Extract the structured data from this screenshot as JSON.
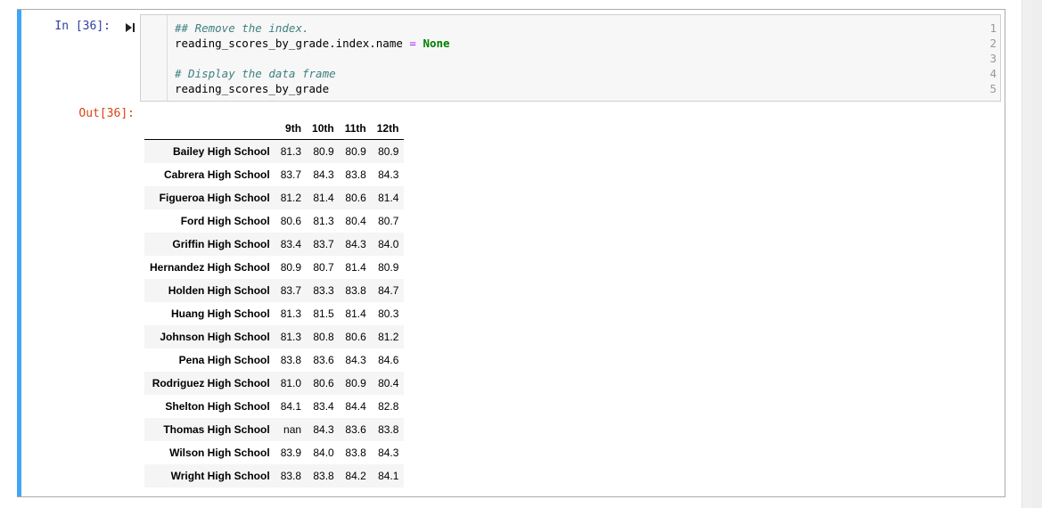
{
  "input": {
    "prompt": "In [36]:",
    "lines": [
      {
        "num": "1",
        "parts": [
          {
            "t": "## Remove the index.",
            "cls": "c-comment"
          }
        ]
      },
      {
        "num": "2",
        "parts": [
          {
            "t": "reading_scores_by_grade.index.name ",
            "cls": ""
          },
          {
            "t": "=",
            "cls": "c-op"
          },
          {
            "t": " ",
            "cls": ""
          },
          {
            "t": "None",
            "cls": "c-kw"
          }
        ]
      },
      {
        "num": "3",
        "parts": []
      },
      {
        "num": "4",
        "parts": [
          {
            "t": "# Display the data frame",
            "cls": "c-comment"
          }
        ]
      },
      {
        "num": "5",
        "parts": [
          {
            "t": "reading_scores_by_grade",
            "cls": ""
          }
        ]
      }
    ]
  },
  "output": {
    "prompt": "Out[36]:",
    "columns": [
      "9th",
      "10th",
      "11th",
      "12th"
    ],
    "rows": [
      {
        "index": "Bailey High School",
        "values": [
          "81.3",
          "80.9",
          "80.9",
          "80.9"
        ]
      },
      {
        "index": "Cabrera High School",
        "values": [
          "83.7",
          "84.3",
          "83.8",
          "84.3"
        ]
      },
      {
        "index": "Figueroa High School",
        "values": [
          "81.2",
          "81.4",
          "80.6",
          "81.4"
        ]
      },
      {
        "index": "Ford High School",
        "values": [
          "80.6",
          "81.3",
          "80.4",
          "80.7"
        ]
      },
      {
        "index": "Griffin High School",
        "values": [
          "83.4",
          "83.7",
          "84.3",
          "84.0"
        ]
      },
      {
        "index": "Hernandez High School",
        "values": [
          "80.9",
          "80.7",
          "81.4",
          "80.9"
        ]
      },
      {
        "index": "Holden High School",
        "values": [
          "83.7",
          "83.3",
          "83.8",
          "84.7"
        ]
      },
      {
        "index": "Huang High School",
        "values": [
          "81.3",
          "81.5",
          "81.4",
          "80.3"
        ]
      },
      {
        "index": "Johnson High School",
        "values": [
          "81.3",
          "80.8",
          "80.6",
          "81.2"
        ]
      },
      {
        "index": "Pena High School",
        "values": [
          "83.8",
          "83.6",
          "84.3",
          "84.6"
        ]
      },
      {
        "index": "Rodriguez High School",
        "values": [
          "81.0",
          "80.6",
          "80.9",
          "80.4"
        ]
      },
      {
        "index": "Shelton High School",
        "values": [
          "84.1",
          "83.4",
          "84.4",
          "82.8"
        ]
      },
      {
        "index": "Thomas High School",
        "values": [
          "nan",
          "84.3",
          "83.6",
          "83.8"
        ]
      },
      {
        "index": "Wilson High School",
        "values": [
          "83.9",
          "84.0",
          "83.8",
          "84.3"
        ]
      },
      {
        "index": "Wright High School",
        "values": [
          "83.8",
          "83.8",
          "84.2",
          "84.1"
        ]
      }
    ]
  },
  "icons": {
    "run": "run-cell-icon"
  },
  "colors": {
    "cell_accent": "#42a5f5",
    "in_prompt": "#303f9f",
    "out_prompt": "#d84315"
  }
}
